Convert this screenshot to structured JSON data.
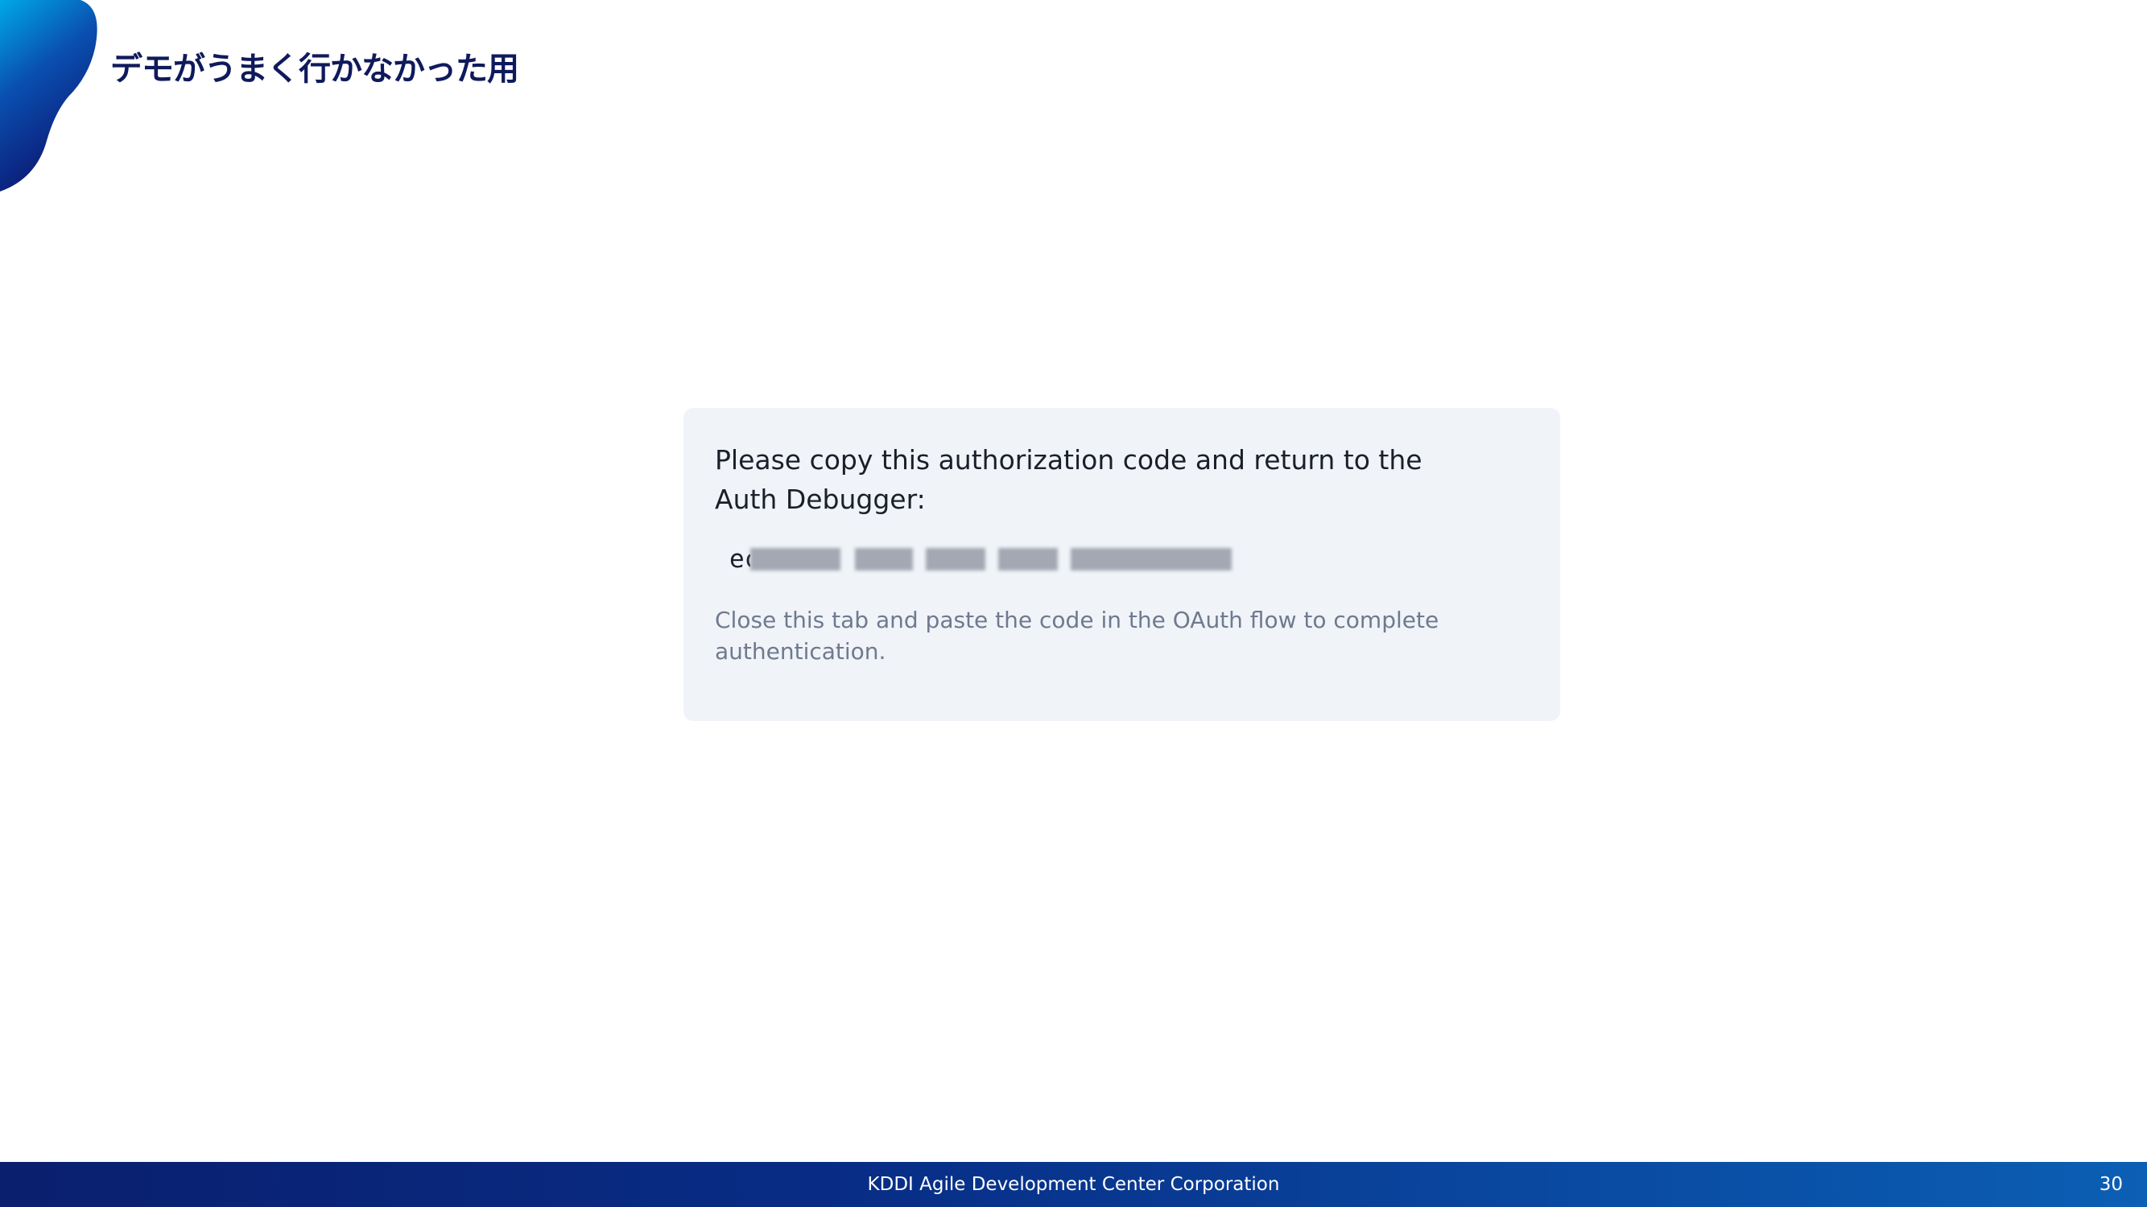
{
  "slide": {
    "title": "デモがうまく行かなかった用",
    "page_number": "30"
  },
  "auth_panel": {
    "heading": "Please copy this authorization code and return to the Auth Debugger:",
    "code_visible_prefix": "ec",
    "note": "Close this tab and paste the code in the OAuth flow to complete authentication."
  },
  "footer": {
    "company": "KDDI Agile Development Center Corporation"
  },
  "colors": {
    "title": "#0f1a5c",
    "panel_background": "#f0f3f8",
    "footer_start": "#0a1f6e",
    "footer_end": "#0b5fb4"
  }
}
